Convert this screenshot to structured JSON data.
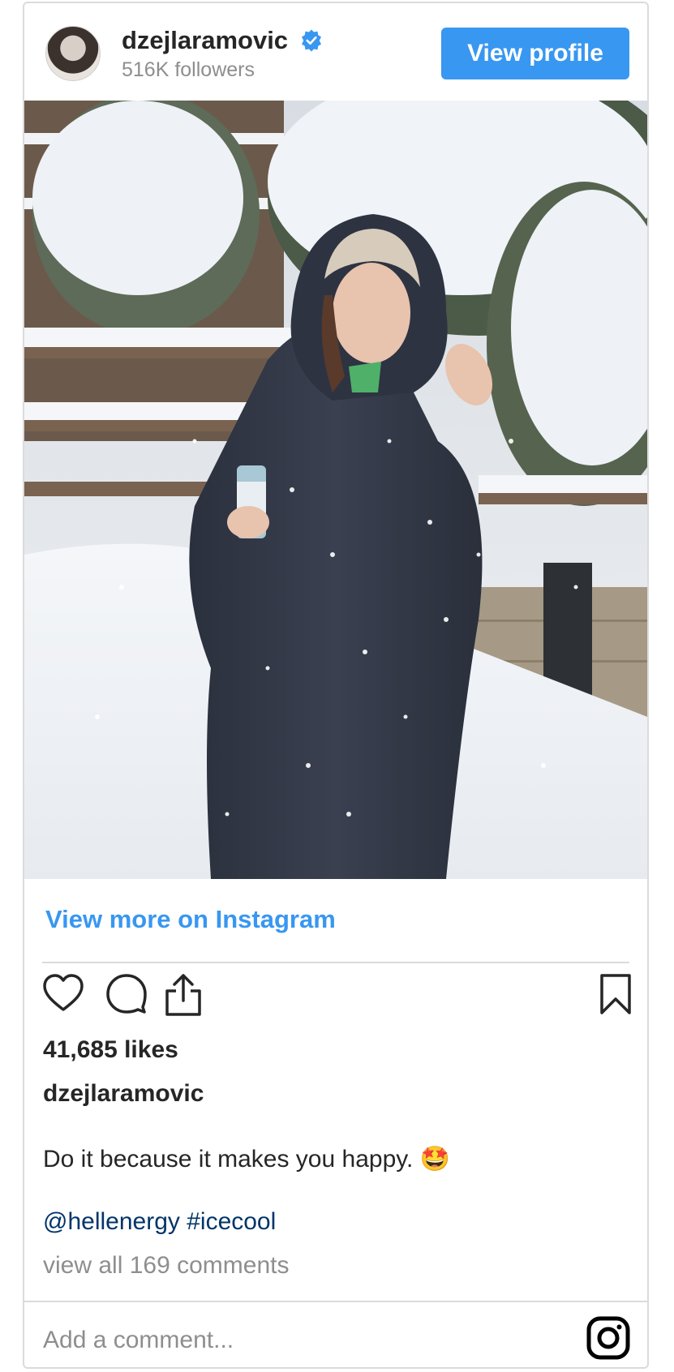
{
  "header": {
    "username": "dzejlaramovic",
    "followers": "516K followers",
    "view_profile_label": "View profile"
  },
  "post": {
    "view_more_label": "View more on Instagram",
    "likes": "41,685 likes",
    "caption_user": "dzejlaramovic",
    "caption_text": "Do it because it makes you happy. 🤩",
    "tags": "@hellenergy #icecool",
    "comments_link": "view all 169 comments"
  },
  "comment": {
    "placeholder": "Add a comment..."
  },
  "icons": [
    "verified-badge-icon",
    "heart-icon",
    "comment-icon",
    "share-icon",
    "bookmark-icon",
    "instagram-logo-icon"
  ],
  "colors": {
    "accent": "#3897f0",
    "link": "#003569",
    "muted": "#8e8e8e",
    "text": "#262626",
    "border": "#dbdbdb"
  }
}
